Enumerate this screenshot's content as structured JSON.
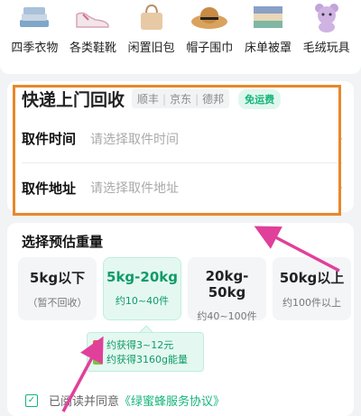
{
  "categories": [
    {
      "label": "四季衣物",
      "icon": "clothes-icon"
    },
    {
      "label": "各类鞋靴",
      "icon": "shoe-icon"
    },
    {
      "label": "闲置旧包",
      "icon": "bag-icon"
    },
    {
      "label": "帽子围巾",
      "icon": "hat-icon"
    },
    {
      "label": "床单被罩",
      "icon": "bedding-icon"
    },
    {
      "label": "毛绒玩具",
      "icon": "plush-toy-icon"
    }
  ],
  "pickup": {
    "title": "快递上门回收",
    "carriers": [
      "顺丰",
      "京东",
      "德邦"
    ],
    "free_tag": "免运费",
    "time_label": "取件时间",
    "time_placeholder": "请选择取件时间",
    "addr_label": "取件地址",
    "addr_placeholder": "请选择取件地址"
  },
  "weight": {
    "title": "选择预估重量",
    "options": [
      {
        "main": "5kg以下",
        "sub": "（暂不回收）"
      },
      {
        "main": "5kg-20kg",
        "sub": "约10~40件"
      },
      {
        "main": "20kg-50kg",
        "sub": "约40~100件"
      },
      {
        "main": "50kg以上",
        "sub": "约100件以上"
      }
    ],
    "selected_index": 1,
    "tip_line1": "约获得3~12元",
    "tip_line2": "约获得3160g能量"
  },
  "agreement": {
    "prefix": "已阅读并同意",
    "link": "《绿蜜蜂服务协议》"
  },
  "colors": {
    "accent": "#15b57a",
    "highlight_box": "#e8882a",
    "annotation_arrow": "#e0409a"
  }
}
